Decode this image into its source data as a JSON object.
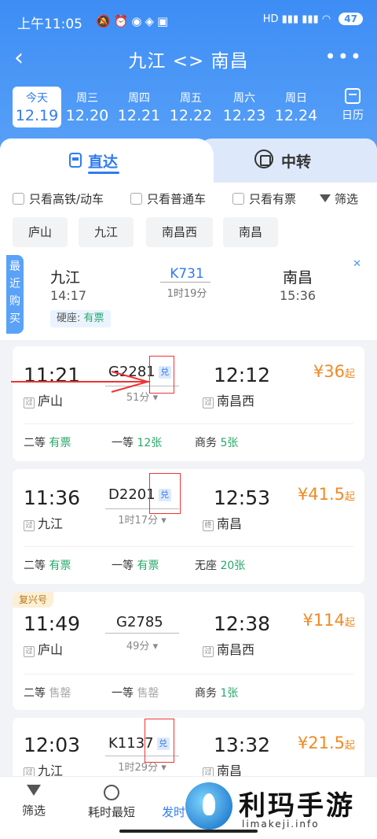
{
  "status_bar": {
    "time": "上午11:05",
    "battery": "47",
    "signal": "HD"
  },
  "header": {
    "title": "九江 <> 南昌",
    "back_icon": "‹",
    "more_icon": "•••"
  },
  "dates": [
    {
      "week": "今天",
      "date": "12.19",
      "selected": true
    },
    {
      "week": "周三",
      "date": "12.20"
    },
    {
      "week": "周四",
      "date": "12.21"
    },
    {
      "week": "周五",
      "date": "12.22"
    },
    {
      "week": "周六",
      "date": "12.23"
    },
    {
      "week": "周日",
      "date": "12.24"
    }
  ],
  "calendar_label": "日历",
  "tabs": {
    "direct": "直达",
    "transfer": "中转"
  },
  "filters": {
    "gaotie": "只看高铁/动车",
    "putong": "只看普通车",
    "youpiao": "只看有票",
    "screen": "筛选"
  },
  "stations": [
    "庐山",
    "九江",
    "南昌西",
    "南昌"
  ],
  "recent": {
    "tag": "最近购买",
    "from": "九江",
    "from_time": "14:17",
    "train": "K731",
    "duration": "1时19分",
    "to": "南昌",
    "to_time": "15:36",
    "seat_label": "硬座:",
    "seat_status": "有票",
    "close": "✕"
  },
  "trains": [
    {
      "dep_time": "11:21",
      "dep_tag": "过",
      "dep_station": "庐山",
      "train_no": "G2281",
      "exchange": "兑",
      "duration": "51分 ▾",
      "arr_time": "12:12",
      "arr_tag": "过",
      "arr_station": "南昌西",
      "price": "¥36",
      "price_suffix": "起",
      "seats": [
        {
          "cls": "二等",
          "status": "有票"
        },
        {
          "cls": "一等",
          "status": "12张"
        },
        {
          "cls": "商务",
          "status": "5张"
        }
      ]
    },
    {
      "dep_time": "11:36",
      "dep_tag": "过",
      "dep_station": "九江",
      "train_no": "D2201",
      "exchange": "兑",
      "duration": "1时17分 ▾",
      "arr_time": "12:53",
      "arr_tag": "终",
      "arr_station": "南昌",
      "price": "¥41.5",
      "price_suffix": "起",
      "seats": [
        {
          "cls": "二等",
          "status": "有票"
        },
        {
          "cls": "一等",
          "status": "有票"
        },
        {
          "cls": "无座",
          "status": "20张"
        }
      ]
    },
    {
      "badge": "复兴号",
      "dep_time": "11:49",
      "dep_tag": "过",
      "dep_station": "庐山",
      "train_no": "G2785",
      "duration": "49分 ▾",
      "arr_time": "12:38",
      "arr_tag": "过",
      "arr_station": "南昌西",
      "price": "¥114",
      "price_suffix": "起",
      "seats": [
        {
          "cls": "二等",
          "status": "售罄"
        },
        {
          "cls": "一等",
          "status": "售罄"
        },
        {
          "cls": "商务",
          "status": "1张"
        }
      ]
    },
    {
      "dep_time": "12:03",
      "dep_tag": "过",
      "dep_station": "九江",
      "train_no": "K1137",
      "exchange": "兑",
      "duration": "1时29分 ▾",
      "arr_time": "13:32",
      "arr_tag": "过",
      "arr_station": "南昌",
      "price": "¥21.5",
      "price_suffix": "起"
    }
  ],
  "bottom_bar": {
    "filter": "筛选",
    "shortest": "耗时最短",
    "depart": "发时"
  },
  "watermark": {
    "text": "利玛手游",
    "url": "limakeji.info"
  },
  "colors": {
    "primary": "#2f7cf0",
    "price": "#f08a24",
    "available": "#27a86a",
    "annotation": "#e33333"
  }
}
